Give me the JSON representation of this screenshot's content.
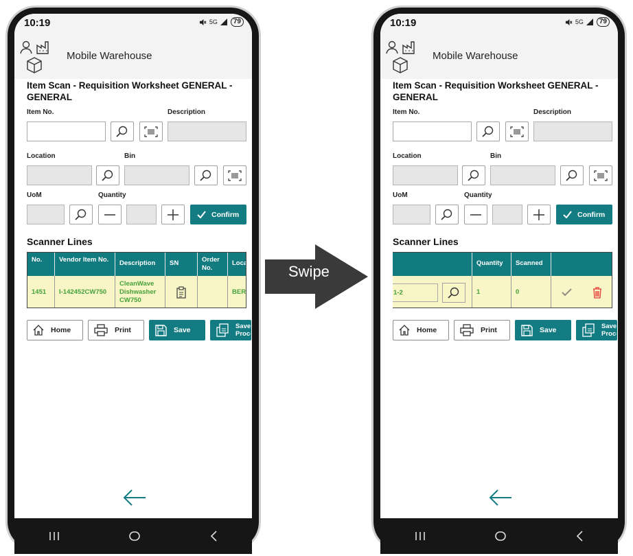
{
  "status": {
    "time": "10:19",
    "battery": "79",
    "signal_text": "5G"
  },
  "app": {
    "title": "Mobile Warehouse"
  },
  "page": {
    "title": "Item Scan - Requisition Worksheet GENERAL - GENERAL"
  },
  "form": {
    "item_no_label": "Item No.",
    "description_label": "Description",
    "location_label": "Location",
    "bin_label": "Bin",
    "uom_label": "UoM",
    "quantity_label": "Quantity",
    "confirm_label": "Confirm"
  },
  "scanner": {
    "title": "Scanner Lines",
    "left_columns": [
      "No.",
      "Vendor Item No.",
      "Description",
      "SN",
      "Order No.",
      "Loca"
    ],
    "left_row": {
      "no": "1451",
      "vendor_item_no": "I-142452CW750",
      "description": "CleanWave Dishwasher CW750",
      "location": "BER"
    },
    "right_columns": [
      "",
      "Quantity",
      "Scanned",
      ""
    ],
    "right_row": {
      "bin": "1-2",
      "quantity": "1",
      "scanned": "0"
    }
  },
  "buttons": {
    "home": "Home",
    "print": "Print",
    "save": "Save",
    "save_process": "Save Process"
  },
  "swipe": {
    "label": "Swipe"
  },
  "colors": {
    "accent": "#137c83",
    "row_bg": "#f8f5c6",
    "row_text": "#45a23a",
    "delete": "#e53935"
  },
  "icons": [
    "user-icon",
    "factory-icon",
    "package-icon",
    "search-icon",
    "barcode-icon",
    "minus-icon",
    "plus-icon",
    "check-icon",
    "clipboard-icon",
    "home-icon",
    "printer-icon",
    "save-icon",
    "save-process-icon",
    "trash-icon",
    "back-arrow-icon",
    "swipe-arrow-icon"
  ]
}
